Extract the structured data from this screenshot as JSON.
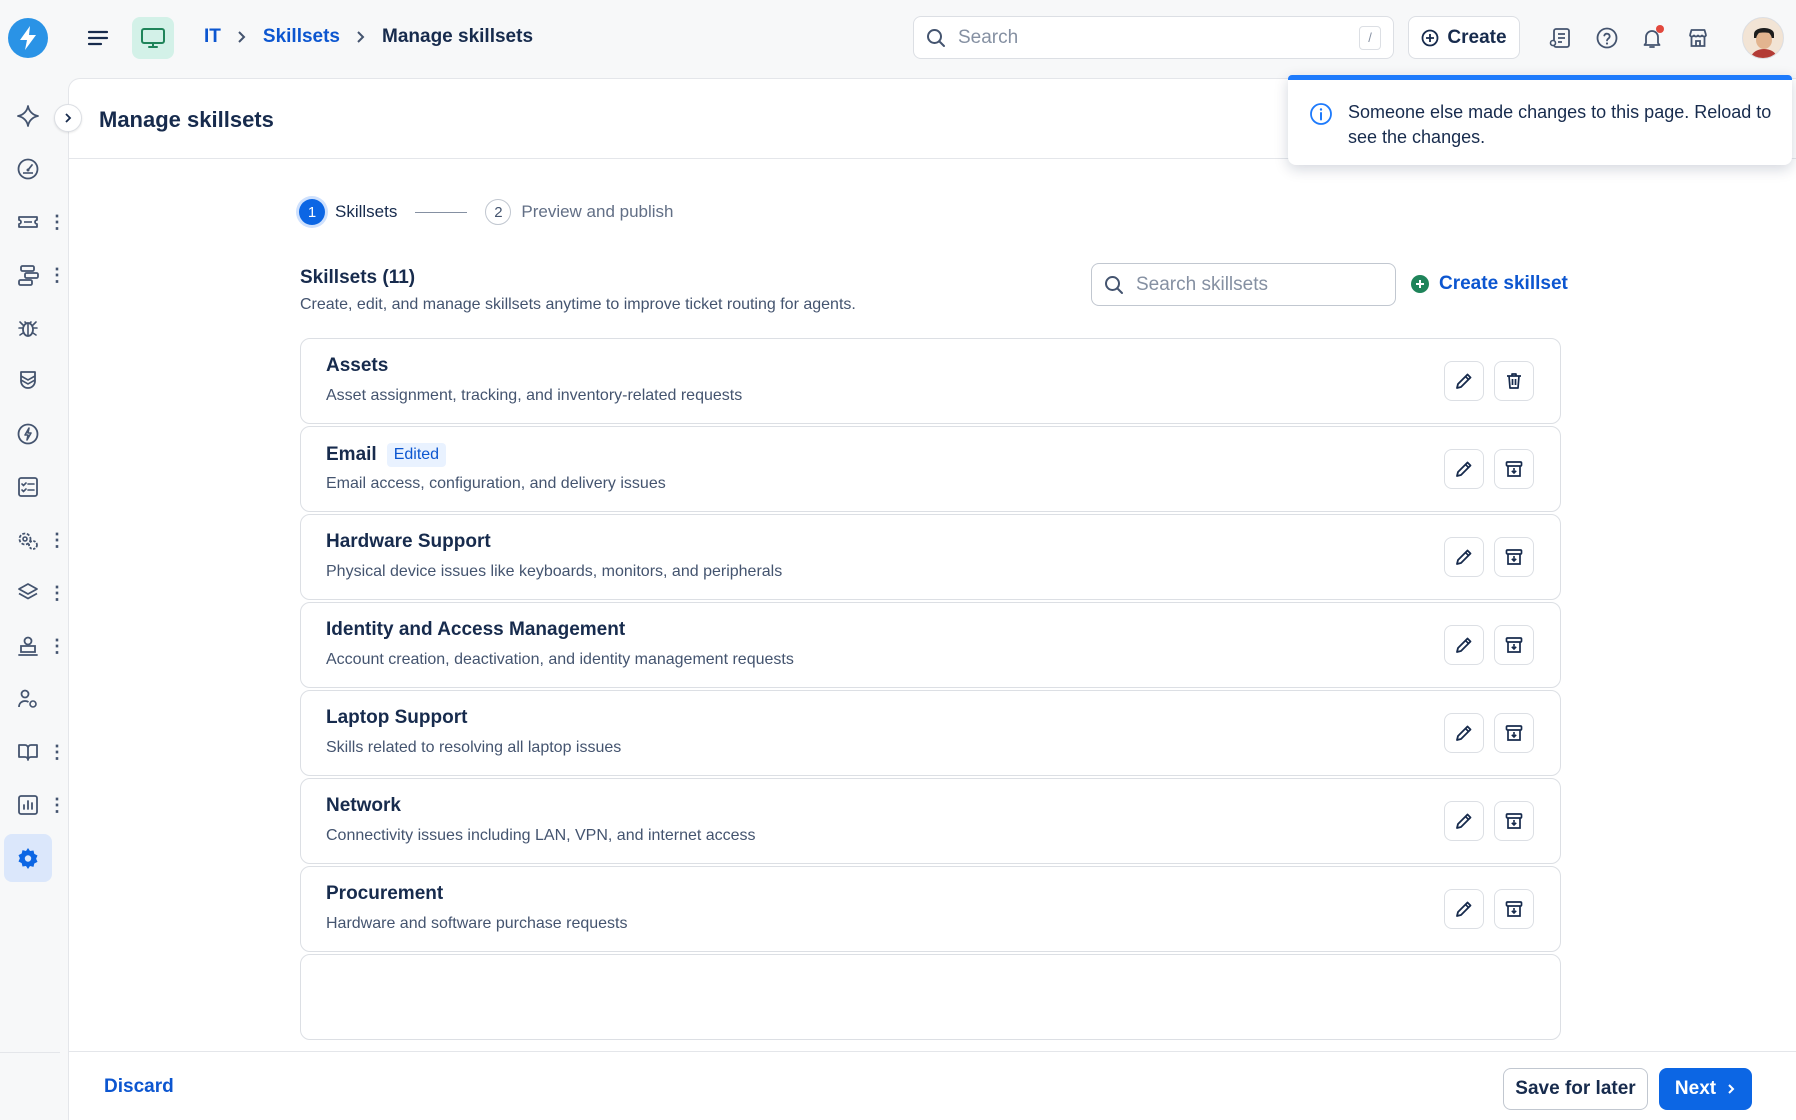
{
  "breadcrumb": {
    "items": [
      "IT",
      "Skillsets"
    ],
    "current": "Manage skillsets"
  },
  "header": {
    "search_placeholder": "Search",
    "search_shortcut": "/",
    "create_label": "Create"
  },
  "page": {
    "title": "Manage skillsets"
  },
  "stepper": {
    "steps": [
      {
        "num": "1",
        "label": "Skillsets",
        "active": true
      },
      {
        "num": "2",
        "label": "Preview and publish",
        "active": false
      }
    ]
  },
  "skillsets": {
    "title": "Skillsets (11)",
    "description": "Create, edit, and manage skillsets anytime to improve ticket routing for agents.",
    "search_placeholder": "Search skillsets",
    "create_label": "Create skillset",
    "items": [
      {
        "name": "Assets",
        "desc": "Asset assignment, tracking, and inventory-related requests",
        "badge": "",
        "action": "delete"
      },
      {
        "name": "Email",
        "desc": "Email access, configuration, and delivery issues",
        "badge": "Edited",
        "action": "archive"
      },
      {
        "name": "Hardware Support",
        "desc": "Physical device issues like keyboards, monitors, and peripherals",
        "badge": "",
        "action": "archive"
      },
      {
        "name": "Identity and Access Management",
        "desc": "Account creation, deactivation, and identity management requests",
        "badge": "",
        "action": "archive"
      },
      {
        "name": "Laptop Support",
        "desc": "Skills related to resolving all laptop issues",
        "badge": "",
        "action": "archive"
      },
      {
        "name": "Network",
        "desc": "Connectivity issues including LAN, VPN, and internet access",
        "badge": "",
        "action": "archive"
      },
      {
        "name": "Procurement",
        "desc": "Hardware and software purchase requests",
        "badge": "",
        "action": "archive"
      }
    ]
  },
  "footer": {
    "discard_label": "Discard",
    "save_label": "Save for later",
    "next_label": "Next"
  },
  "toast": {
    "message": "Someone else made changes to this page. Reload to see the changes."
  },
  "colors": {
    "primary": "#0c66e4",
    "link": "#0c56d0",
    "success": "#1f845a",
    "toast_border": "#1d7afc"
  }
}
